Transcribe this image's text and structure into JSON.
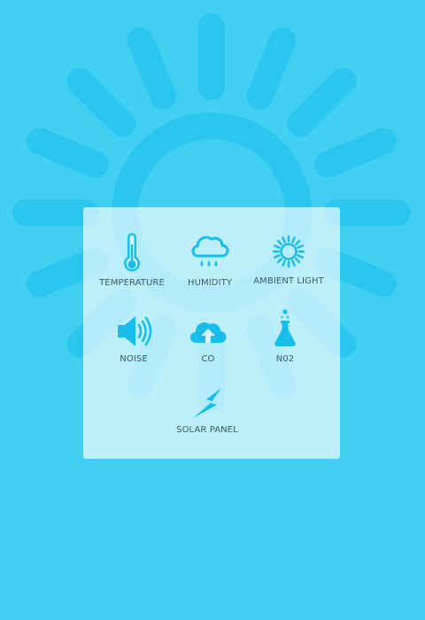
{
  "colors": {
    "background": "#42d0f2",
    "sun_watermark": "#2ac6ef",
    "icon": "#19bdea",
    "label": "#3c5a66",
    "panel": "rgba(255,255,255,0.65)"
  },
  "sensors": [
    {
      "id": "temperature",
      "label": "TEMPERATURE",
      "icon": "thermometer-icon"
    },
    {
      "id": "humidity",
      "label": "HUMIDITY",
      "icon": "rain-cloud-icon"
    },
    {
      "id": "ambient-light",
      "label": "AMBIENT LIGHT",
      "icon": "sun-icon"
    },
    {
      "id": "noise",
      "label": "NOISE",
      "icon": "speaker-icon"
    },
    {
      "id": "co",
      "label": "CO",
      "icon": "cloud-upload-icon"
    },
    {
      "id": "no2",
      "label": "N02",
      "icon": "flask-icon"
    },
    {
      "id": "solar-panel",
      "label": "SOLAR PANEL",
      "icon": "lightning-icon"
    }
  ]
}
